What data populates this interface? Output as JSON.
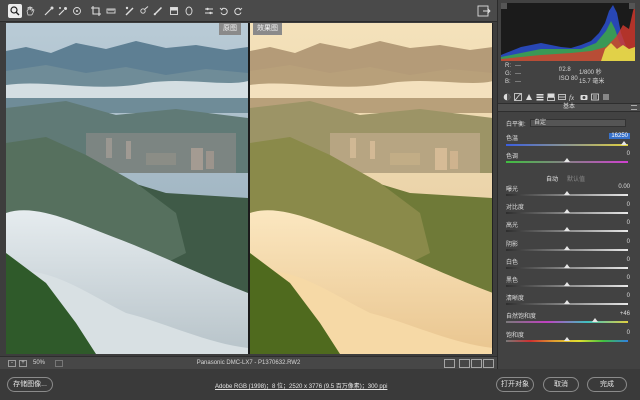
{
  "toolbar": {
    "tools": [
      "zoom-tool",
      "hand-tool",
      "white-balance-tool",
      "color-sampler-tool",
      "targeted-adjustment-tool",
      "crop-tool",
      "straighten-tool",
      "spot-removal-tool",
      "red-eye-tool",
      "adjustment-brush",
      "graduated-filter",
      "radial-filter",
      "preferences",
      "rotate-ccw",
      "rotate-cw"
    ],
    "active_tool": "zoom-tool"
  },
  "preview": {
    "before_label": "原图",
    "after_label": "效果图"
  },
  "statusbar": {
    "zoom_minus": "-",
    "zoom_plus": "+",
    "zoom_level": "50%",
    "filename": "Panasonic DMC-LX7  -  P1370632.RW2"
  },
  "readout": {
    "r_label": "R:",
    "r_value": "---",
    "g_label": "G:",
    "g_value": "---",
    "b_label": "B:",
    "b_value": "---",
    "aperture": "f/2.8",
    "shutter": "1/800 秒",
    "iso": "ISO 80",
    "focal": "15.7 毫米"
  },
  "panel": {
    "section_title": "基本",
    "white_balance_label": "白平衡:",
    "white_balance_value": "自定",
    "temperature_label": "色温",
    "temperature_value": "16250",
    "tint_label": "色调",
    "tint_value": "0",
    "auto_label": "自动",
    "default_label": "默认值",
    "adjustments": [
      {
        "label": "曝光",
        "value": "0.00",
        "position": 0.5
      },
      {
        "label": "对比度",
        "value": "0",
        "position": 0.5
      },
      {
        "label": "高光",
        "value": "0",
        "position": 0.5
      },
      {
        "label": "阴影",
        "value": "0",
        "position": 0.5
      },
      {
        "label": "白色",
        "value": "0",
        "position": 0.5
      },
      {
        "label": "黑色",
        "value": "0",
        "position": 0.5
      },
      {
        "label": "清晰度",
        "value": "0",
        "position": 0.5
      },
      {
        "label": "自然饱和度",
        "value": "+46",
        "position": 0.73
      },
      {
        "label": "饱和度",
        "value": "0",
        "position": 0.5
      }
    ],
    "temperature_position": 0.97,
    "tint_position": 0.5
  },
  "bottombar": {
    "save_label": "存储图像...",
    "workflow_text": "Adobe RGB (1998)；8 位；2520 x 3776 (9.5 百万像素)；300 ppi",
    "open_label": "打开对象",
    "cancel_label": "取消",
    "done_label": "完成"
  },
  "colors": {
    "accent": "#3770c8",
    "panel_bg": "#424242",
    "toolbar_bg": "#4a4a4a"
  }
}
